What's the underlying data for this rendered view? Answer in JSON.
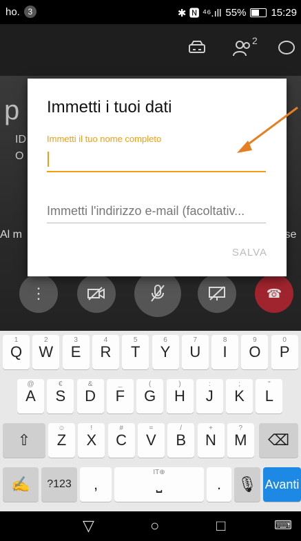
{
  "status_bar": {
    "carrier": "ho.",
    "notif_count": "3",
    "signals": "✱ 🅽 ⁴⁶.ıll",
    "battery": "55%",
    "time": "15:29"
  },
  "app_bar": {
    "icons": [
      "car-icon",
      "participants-icon",
      "chat-icon"
    ],
    "participants_count": "2"
  },
  "background": {
    "left_label": "Al m",
    "right_label": "ise",
    "letter_p": "p",
    "side_text_1": "ID",
    "side_text_2": "O"
  },
  "dialog": {
    "title": "Immetti i tuoi dati",
    "name_label": "Immetti il tuo nome completo",
    "name_value": "",
    "email_placeholder": "Immetti l'indirizzo e-mail (facoltativ...",
    "save_label": "SALVA"
  },
  "keyboard": {
    "row1": [
      {
        "k": "Q",
        "h": "1"
      },
      {
        "k": "W",
        "h": "2"
      },
      {
        "k": "E",
        "h": "3"
      },
      {
        "k": "R",
        "h": "4"
      },
      {
        "k": "T",
        "h": "5"
      },
      {
        "k": "Y",
        "h": "6"
      },
      {
        "k": "U",
        "h": "7"
      },
      {
        "k": "I",
        "h": "8"
      },
      {
        "k": "O",
        "h": "9"
      },
      {
        "k": "P",
        "h": "0"
      }
    ],
    "row2": [
      {
        "k": "A",
        "h": "@"
      },
      {
        "k": "S",
        "h": "€"
      },
      {
        "k": "D",
        "h": "&"
      },
      {
        "k": "F",
        "h": "_"
      },
      {
        "k": "G",
        "h": "("
      },
      {
        "k": "H",
        "h": ")"
      },
      {
        "k": "J",
        "h": ":"
      },
      {
        "k": "K",
        "h": ";"
      },
      {
        "k": "L",
        "h": "\""
      }
    ],
    "row3": [
      {
        "k": "Z",
        "h": "☺"
      },
      {
        "k": "X",
        "h": "!"
      },
      {
        "k": "C",
        "h": "#"
      },
      {
        "k": "V",
        "h": "="
      },
      {
        "k": "B",
        "h": "/"
      },
      {
        "k": "N",
        "h": "+"
      },
      {
        "k": "M",
        "h": "?"
      }
    ],
    "sym_label": "?123",
    "comma": ",",
    "space_hint": "IT⊕",
    "period": ".",
    "enter_label": "Avanti"
  }
}
